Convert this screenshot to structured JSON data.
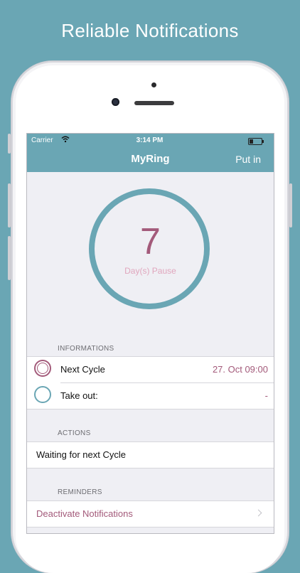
{
  "headline": "Reliable Notifications",
  "status_bar": {
    "carrier": "Carrier",
    "wifi_icon": "wifi-icon",
    "time": "3:14 PM",
    "battery_icon": "battery-icon"
  },
  "navbar": {
    "title": "MyRing",
    "action_label": "Put in"
  },
  "ring": {
    "count": "7",
    "caption": "Day(s) Pause"
  },
  "informations": {
    "header": "INFORMATIONS",
    "rows": [
      {
        "label": "Next Cycle",
        "value": "27. Oct 09:00",
        "icon": "circle-icon"
      },
      {
        "label": "Take out:",
        "value": "-",
        "icon": "circle-icon"
      }
    ]
  },
  "actions": {
    "header": "ACTIONS",
    "status": "Waiting for next Cycle"
  },
  "reminders": {
    "header": "REMINDERS",
    "deactivate_label": "Deactivate Notifications",
    "chevron_icon": "chevron-right-icon"
  },
  "colors": {
    "accent": "#6aa6b4",
    "highlight": "#a35a7a",
    "caption": "#e0a6bd"
  }
}
